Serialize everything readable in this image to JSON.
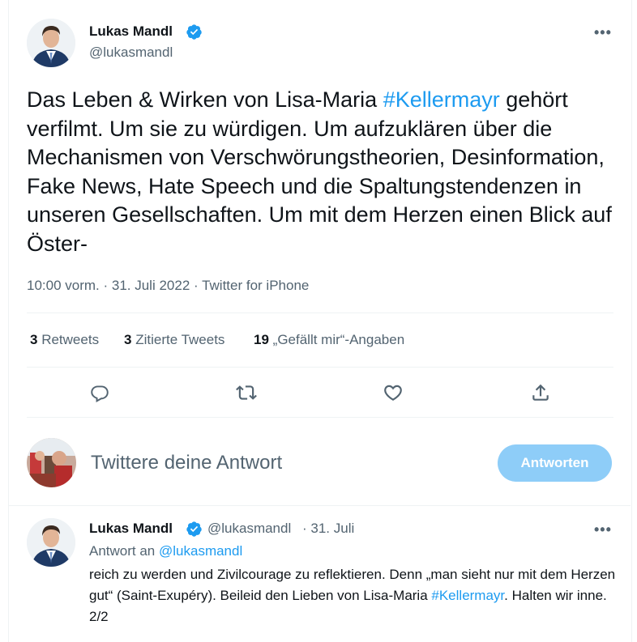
{
  "main_tweet": {
    "author_name": "Lukas Mandl",
    "author_handle": "@lukasmandl",
    "more_label": "•••",
    "text_before": "Das Leben & Wirken von Lisa-Maria ",
    "hashtag": "#Kellermayr",
    "text_after": " gehört verfilmt. Um sie zu würdigen. Um aufzuklären über die Mechanismen von Verschwörungstheorien, Desinformation, Fake News, Hate Speech und die Spaltungstendenzen in unseren Gesellschaften. Um mit dem Herzen einen Blick auf Öster-",
    "timestamp": "10:00 vorm. · 31. Juli 2022 · Twitter for iPhone",
    "retweets_count": "3",
    "retweets_label": "Retweets",
    "quotes_count": "3",
    "quotes_label": "Zitierte Tweets",
    "likes_count": "19",
    "likes_label": "„Gefällt mir“-Angaben",
    "colors": {
      "verified": "#1d9bf0",
      "link": "#1d9bf0",
      "secondary": "#536471"
    }
  },
  "actions": [
    {
      "name": "reply-icon"
    },
    {
      "name": "retweet-icon"
    },
    {
      "name": "like-icon"
    },
    {
      "name": "share-icon"
    }
  ],
  "compose": {
    "placeholder": "Twittere deine Antwort",
    "button_label": "Antworten"
  },
  "reply_tweet": {
    "author_name": "Lukas Mandl",
    "author_handle": "@lukasmandl",
    "date": "· 31. Juli",
    "more_label": "•••",
    "reply_to_prefix": "Antwort an ",
    "reply_to_handle": "@lukasmandl",
    "text_before": "reich zu werden und Zivilcourage zu reflektieren. Denn „man sieht nur mit dem Herzen gut“ (Saint-Exupéry). Beileid den Lieben von Lisa-Maria ",
    "hashtag": "#Kellermayr",
    "text_after": ". Halten wir inne. 2/2"
  }
}
